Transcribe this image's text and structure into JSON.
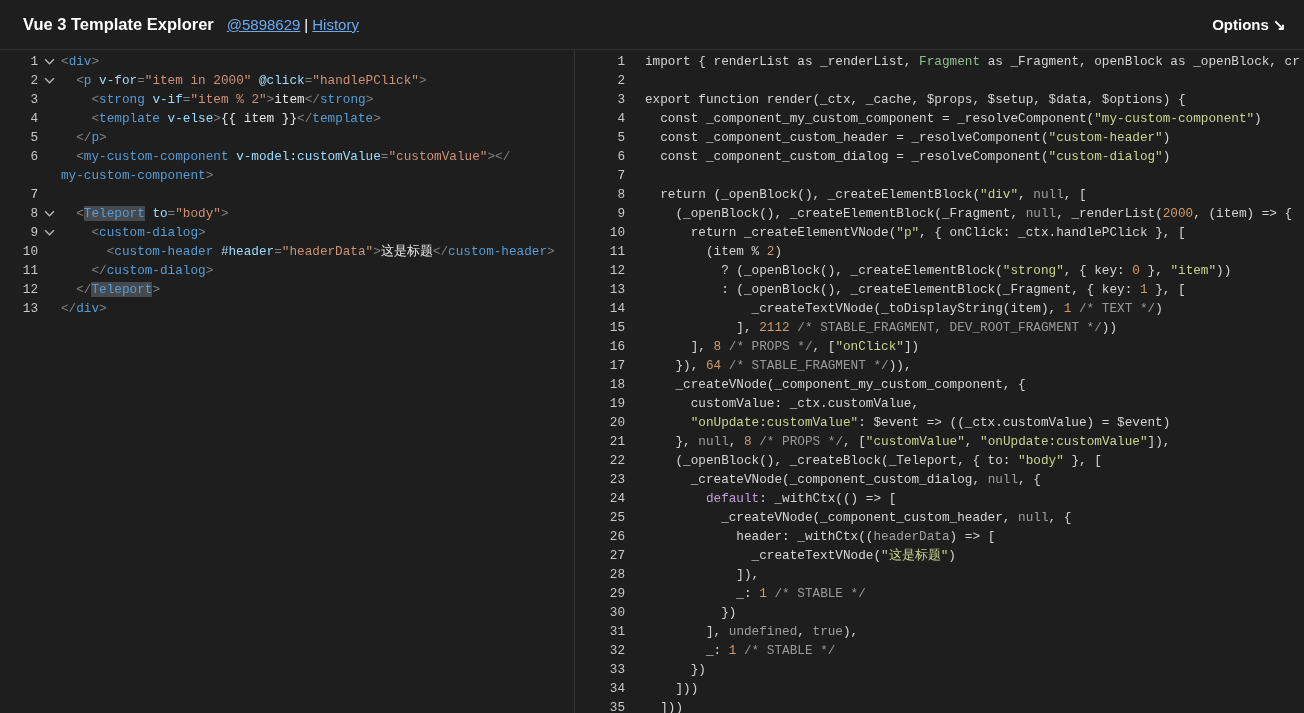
{
  "header": {
    "title": "Vue 3 Template Explorer",
    "commit_link": "@5898629",
    "separator": "|",
    "history_link": "History",
    "options": "Options ↘"
  },
  "template_editor": {
    "lines": [
      {
        "number": "1",
        "foldable": true,
        "tokens": [
          {
            "kind": "bracket",
            "text": "<"
          },
          {
            "kind": "tag",
            "text": "div"
          },
          {
            "kind": "bracket",
            "text": ">"
          }
        ]
      },
      {
        "number": "2",
        "foldable": true,
        "tokens": [
          {
            "kind": "bracket",
            "text": "  <"
          },
          {
            "kind": "tag",
            "text": "p"
          },
          {
            "kind": "attr",
            "text": " v-for"
          },
          {
            "kind": "bracket",
            "text": "="
          },
          {
            "kind": "string",
            "text": "\"item in 2000\""
          },
          {
            "kind": "attr",
            "text": " @click"
          },
          {
            "kind": "bracket",
            "text": "="
          },
          {
            "kind": "string",
            "text": "\"handlePClick\""
          },
          {
            "kind": "bracket",
            "text": ">"
          }
        ]
      },
      {
        "number": "3",
        "foldable": false,
        "tokens": [
          {
            "kind": "bracket",
            "text": "    <"
          },
          {
            "kind": "tag",
            "text": "strong"
          },
          {
            "kind": "attr",
            "text": " v-if"
          },
          {
            "kind": "bracket",
            "text": "="
          },
          {
            "kind": "string",
            "text": "\"item % 2\""
          },
          {
            "kind": "bracket",
            "text": ">"
          },
          {
            "kind": "text",
            "text": "item"
          },
          {
            "kind": "bracket",
            "text": "</"
          },
          {
            "kind": "tag",
            "text": "strong"
          },
          {
            "kind": "bracket",
            "text": ">"
          }
        ]
      },
      {
        "number": "4",
        "foldable": false,
        "tokens": [
          {
            "kind": "bracket",
            "text": "    <"
          },
          {
            "kind": "tag",
            "text": "template"
          },
          {
            "kind": "attr",
            "text": " v-else"
          },
          {
            "kind": "bracket",
            "text": ">"
          },
          {
            "kind": "text",
            "text": "{{ item }}"
          },
          {
            "kind": "bracket",
            "text": "</"
          },
          {
            "kind": "tag",
            "text": "template"
          },
          {
            "kind": "bracket",
            "text": ">"
          }
        ]
      },
      {
        "number": "5",
        "foldable": false,
        "tokens": [
          {
            "kind": "bracket",
            "text": "  </"
          },
          {
            "kind": "tag",
            "text": "p"
          },
          {
            "kind": "bracket",
            "text": ">"
          }
        ]
      },
      {
        "number": "6",
        "foldable": false,
        "tokens": [
          {
            "kind": "bracket",
            "text": "  <"
          },
          {
            "kind": "tag",
            "text": "my-custom-component"
          },
          {
            "kind": "attr",
            "text": " v-model:customValue"
          },
          {
            "kind": "bracket",
            "text": "="
          },
          {
            "kind": "string",
            "text": "\"customValue\""
          },
          {
            "kind": "bracket",
            "text": "></"
          }
        ],
        "continuation": [
          {
            "kind": "tag",
            "text": "my-custom-component"
          },
          {
            "kind": "bracket",
            "text": ">"
          }
        ]
      },
      {
        "number": "7",
        "foldable": false
      },
      {
        "number": "8",
        "foldable": true,
        "tokens": [
          {
            "kind": "bracket",
            "text": "  <"
          },
          {
            "kind": "match",
            "text": "Teleport"
          },
          {
            "kind": "attr",
            "text": " to"
          },
          {
            "kind": "bracket",
            "text": "="
          },
          {
            "kind": "string",
            "text": "\"body\""
          },
          {
            "kind": "bracket",
            "text": ">"
          }
        ]
      },
      {
        "number": "9",
        "foldable": true,
        "tokens": [
          {
            "kind": "bracket",
            "text": "    <"
          },
          {
            "kind": "tag",
            "text": "custom-dialog"
          },
          {
            "kind": "bracket",
            "text": ">"
          }
        ]
      },
      {
        "number": "10",
        "foldable": false,
        "tokens": [
          {
            "kind": "bracket",
            "text": "      <"
          },
          {
            "kind": "tag",
            "text": "custom-header"
          },
          {
            "kind": "attr",
            "text": " #header"
          },
          {
            "kind": "bracket",
            "text": "="
          },
          {
            "kind": "string",
            "text": "\"headerData\""
          },
          {
            "kind": "bracket",
            "text": ">"
          },
          {
            "kind": "text",
            "text": "这是标题"
          },
          {
            "kind": "bracket",
            "text": "</"
          },
          {
            "kind": "tag",
            "text": "custom-header"
          },
          {
            "kind": "bracket",
            "text": ">"
          }
        ]
      },
      {
        "number": "11",
        "foldable": false,
        "tokens": [
          {
            "kind": "bracket",
            "text": "    </"
          },
          {
            "kind": "tag",
            "text": "custom-dialog"
          },
          {
            "kind": "bracket",
            "text": ">"
          }
        ]
      },
      {
        "number": "12",
        "foldable": false,
        "tokens": [
          {
            "kind": "bracket",
            "text": "  </"
          },
          {
            "kind": "match",
            "text": "Teleport"
          },
          {
            "kind": "bracket",
            "text": ">"
          }
        ]
      },
      {
        "number": "13",
        "foldable": false,
        "tokens": [
          {
            "kind": "bracket",
            "text": "</"
          },
          {
            "kind": "tag",
            "text": "div"
          },
          {
            "kind": "bracket",
            "text": ">"
          }
        ]
      }
    ]
  },
  "output_editor": {
    "lines": [
      {
        "number": "1",
        "tokens": [
          {
            "kind": "plain",
            "text": "import { renderList as _renderList, "
          },
          {
            "kind": "type",
            "text": "Fragment"
          },
          {
            "kind": "plain",
            "text": " as _Fragment, openBlock as _openBlock, cr"
          }
        ]
      },
      {
        "number": "2"
      },
      {
        "number": "3",
        "tokens": [
          {
            "kind": "plain",
            "text": "export function render(_ctx, _cache, $props, $setup, $data, $options) {"
          }
        ]
      },
      {
        "number": "4",
        "tokens": [
          {
            "kind": "plain",
            "text": "  const _component_my_custom_component = _resolveComponent("
          },
          {
            "kind": "string",
            "text": "\"my-custom-component\""
          },
          {
            "kind": "plain",
            "text": ")"
          }
        ]
      },
      {
        "number": "5",
        "tokens": [
          {
            "kind": "plain",
            "text": "  const _component_custom_header = _resolveComponent("
          },
          {
            "kind": "string",
            "text": "\"custom-header\""
          },
          {
            "kind": "plain",
            "text": ")"
          }
        ]
      },
      {
        "number": "6",
        "tokens": [
          {
            "kind": "plain",
            "text": "  const _component_custom_dialog = _resolveComponent("
          },
          {
            "kind": "string",
            "text": "\"custom-dialog\""
          },
          {
            "kind": "plain",
            "text": ")"
          }
        ]
      },
      {
        "number": "7"
      },
      {
        "number": "8",
        "tokens": [
          {
            "kind": "plain",
            "text": "  return (_openBlock(), _createElementBlock("
          },
          {
            "kind": "string",
            "text": "\"div\""
          },
          {
            "kind": "plain",
            "text": ", "
          },
          {
            "kind": "literal",
            "text": "null"
          },
          {
            "kind": "plain",
            "text": ", ["
          }
        ]
      },
      {
        "number": "9",
        "tokens": [
          {
            "kind": "plain",
            "text": "    (_openBlock(), _createElementBlock(_Fragment, "
          },
          {
            "kind": "literal",
            "text": "null"
          },
          {
            "kind": "plain",
            "text": ", _renderList("
          },
          {
            "kind": "number",
            "text": "2000"
          },
          {
            "kind": "plain",
            "text": ", (item) => {"
          }
        ]
      },
      {
        "number": "10",
        "tokens": [
          {
            "kind": "plain",
            "text": "      return _createElementVNode("
          },
          {
            "kind": "string",
            "text": "\"p\""
          },
          {
            "kind": "plain",
            "text": ", { onClick: _ctx.handlePClick }, ["
          }
        ]
      },
      {
        "number": "11",
        "tokens": [
          {
            "kind": "plain",
            "text": "        (item % "
          },
          {
            "kind": "number",
            "text": "2"
          },
          {
            "kind": "plain",
            "text": ")"
          }
        ]
      },
      {
        "number": "12",
        "tokens": [
          {
            "kind": "plain",
            "text": "          ? (_openBlock(), _createElementBlock("
          },
          {
            "kind": "string",
            "text": "\"strong\""
          },
          {
            "kind": "plain",
            "text": ", { key: "
          },
          {
            "kind": "number",
            "text": "0"
          },
          {
            "kind": "plain",
            "text": " }, "
          },
          {
            "kind": "string",
            "text": "\"item\""
          },
          {
            "kind": "plain",
            "text": "))"
          }
        ]
      },
      {
        "number": "13",
        "tokens": [
          {
            "kind": "plain",
            "text": "          : (_openBlock(), _createElementBlock(_Fragment, { key: "
          },
          {
            "kind": "number",
            "text": "1"
          },
          {
            "kind": "plain",
            "text": " }, ["
          }
        ]
      },
      {
        "number": "14",
        "tokens": [
          {
            "kind": "plain",
            "text": "              _createTextVNode(_toDisplayString(item), "
          },
          {
            "kind": "number",
            "text": "1"
          },
          {
            "kind": "comment",
            "text": " /* TEXT */"
          },
          {
            "kind": "plain",
            "text": ")"
          }
        ]
      },
      {
        "number": "15",
        "tokens": [
          {
            "kind": "plain",
            "text": "            ], "
          },
          {
            "kind": "number",
            "text": "2112"
          },
          {
            "kind": "comment",
            "text": " /* STABLE_FRAGMENT, DEV_ROOT_FRAGMENT */"
          },
          {
            "kind": "plain",
            "text": "))"
          }
        ]
      },
      {
        "number": "16",
        "tokens": [
          {
            "kind": "plain",
            "text": "      ], "
          },
          {
            "kind": "number",
            "text": "8"
          },
          {
            "kind": "comment",
            "text": " /* PROPS */"
          },
          {
            "kind": "plain",
            "text": ", ["
          },
          {
            "kind": "string",
            "text": "\"onClick\""
          },
          {
            "kind": "plain",
            "text": "])"
          }
        ]
      },
      {
        "number": "17",
        "tokens": [
          {
            "kind": "plain",
            "text": "    }), "
          },
          {
            "kind": "number",
            "text": "64"
          },
          {
            "kind": "comment",
            "text": " /* STABLE_FRAGMENT */"
          },
          {
            "kind": "plain",
            "text": ")),"
          }
        ]
      },
      {
        "number": "18",
        "tokens": [
          {
            "kind": "plain",
            "text": "    _createVNode(_component_my_custom_component, {"
          }
        ]
      },
      {
        "number": "19",
        "tokens": [
          {
            "kind": "plain",
            "text": "      customValue: _ctx.customValue,"
          }
        ]
      },
      {
        "number": "20",
        "tokens": [
          {
            "kind": "string",
            "text": "      \"onUpdate:customValue\""
          },
          {
            "kind": "plain",
            "text": ": $event => ((_ctx.customValue) = $event)"
          }
        ]
      },
      {
        "number": "21",
        "tokens": [
          {
            "kind": "plain",
            "text": "    }, "
          },
          {
            "kind": "literal",
            "text": "null"
          },
          {
            "kind": "plain",
            "text": ", "
          },
          {
            "kind": "number",
            "text": "8"
          },
          {
            "kind": "comment",
            "text": " /* PROPS */"
          },
          {
            "kind": "plain",
            "text": ", ["
          },
          {
            "kind": "string",
            "text": "\"customValue\""
          },
          {
            "kind": "plain",
            "text": ", "
          },
          {
            "kind": "string",
            "text": "\"onUpdate:customValue\""
          },
          {
            "kind": "plain",
            "text": "]),"
          }
        ]
      },
      {
        "number": "22",
        "tokens": [
          {
            "kind": "plain",
            "text": "    (_openBlock(), _createBlock(_Teleport, { to: "
          },
          {
            "kind": "string",
            "text": "\"body\""
          },
          {
            "kind": "plain",
            "text": " }, ["
          }
        ]
      },
      {
        "number": "23",
        "tokens": [
          {
            "kind": "plain",
            "text": "      _createVNode(_component_custom_dialog, "
          },
          {
            "kind": "literal",
            "text": "null"
          },
          {
            "kind": "plain",
            "text": ", {"
          }
        ]
      },
      {
        "number": "24",
        "tokens": [
          {
            "kind": "keyword",
            "text": "        default"
          },
          {
            "kind": "plain",
            "text": ": _withCtx(() => ["
          }
        ]
      },
      {
        "number": "25",
        "tokens": [
          {
            "kind": "plain",
            "text": "          _createVNode(_component_custom_header, "
          },
          {
            "kind": "literal",
            "text": "null"
          },
          {
            "kind": "plain",
            "text": ", {"
          }
        ]
      },
      {
        "number": "26",
        "tokens": [
          {
            "kind": "plain",
            "text": "            header: _withCtx(("
          },
          {
            "kind": "param",
            "text": "headerData"
          },
          {
            "kind": "plain",
            "text": ") => ["
          }
        ]
      },
      {
        "number": "27",
        "tokens": [
          {
            "kind": "plain",
            "text": "              _createTextVNode("
          },
          {
            "kind": "string",
            "text": "\"这是标题\""
          },
          {
            "kind": "plain",
            "text": ")"
          }
        ]
      },
      {
        "number": "28",
        "tokens": [
          {
            "kind": "plain",
            "text": "            ]),"
          }
        ]
      },
      {
        "number": "29",
        "tokens": [
          {
            "kind": "plain",
            "text": "            _: "
          },
          {
            "kind": "number",
            "text": "1"
          },
          {
            "kind": "comment",
            "text": " /* STABLE */"
          }
        ]
      },
      {
        "number": "30",
        "tokens": [
          {
            "kind": "plain",
            "text": "          })"
          }
        ]
      },
      {
        "number": "31",
        "tokens": [
          {
            "kind": "plain",
            "text": "        ], "
          },
          {
            "kind": "literal",
            "text": "undefined"
          },
          {
            "kind": "plain",
            "text": ", "
          },
          {
            "kind": "literal",
            "text": "true"
          },
          {
            "kind": "plain",
            "text": "),"
          }
        ]
      },
      {
        "number": "32",
        "tokens": [
          {
            "kind": "plain",
            "text": "        _: "
          },
          {
            "kind": "number",
            "text": "1"
          },
          {
            "kind": "comment",
            "text": " /* STABLE */"
          }
        ]
      },
      {
        "number": "33",
        "tokens": [
          {
            "kind": "plain",
            "text": "      })"
          }
        ]
      },
      {
        "number": "34",
        "tokens": [
          {
            "kind": "plain",
            "text": "    ]))"
          }
        ]
      },
      {
        "number": "35",
        "tokens": [
          {
            "kind": "plain",
            "text": "  ]))"
          }
        ]
      }
    ]
  }
}
